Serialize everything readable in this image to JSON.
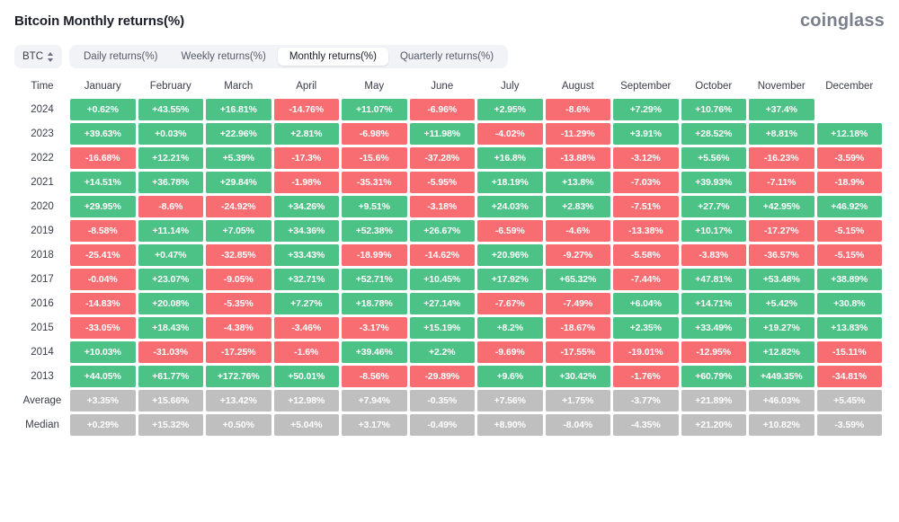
{
  "header": {
    "title": "Bitcoin Monthly returns(%)",
    "brand": "coinglass"
  },
  "controls": {
    "symbol": "BTC",
    "symbol_icon": "updown-chevron-icon",
    "tabs": [
      {
        "label": "Daily returns(%)",
        "active": false
      },
      {
        "label": "Weekly returns(%)",
        "active": false
      },
      {
        "label": "Monthly returns(%)",
        "active": true
      },
      {
        "label": "Quarterly returns(%)",
        "active": false
      }
    ]
  },
  "colors": {
    "positive": "#4cc286",
    "negative": "#f76d72",
    "neutral": "#bfbfbf",
    "brand": "#7a7f8c",
    "tabbar_bg": "#f1f3f6"
  },
  "chart_data": {
    "type": "heatmap",
    "title": "Bitcoin Monthly returns(%)",
    "xlabel": "",
    "ylabel": "Time",
    "columns": [
      "Time",
      "January",
      "February",
      "March",
      "April",
      "May",
      "June",
      "July",
      "August",
      "September",
      "October",
      "November",
      "December"
    ],
    "categories": [
      "January",
      "February",
      "March",
      "April",
      "May",
      "June",
      "July",
      "August",
      "September",
      "October",
      "November",
      "December"
    ],
    "rows": [
      {
        "label": "2024",
        "kind": "year",
        "values": [
          "+0.62%",
          "+43.55%",
          "+16.81%",
          "-14.76%",
          "+11.07%",
          "-6.96%",
          "+2.95%",
          "-8.6%",
          "+7.29%",
          "+10.76%",
          "+37.4%",
          ""
        ]
      },
      {
        "label": "2023",
        "kind": "year",
        "values": [
          "+39.63%",
          "+0.03%",
          "+22.96%",
          "+2.81%",
          "-6.98%",
          "+11.98%",
          "-4.02%",
          "-11.29%",
          "+3.91%",
          "+28.52%",
          "+8.81%",
          "+12.18%"
        ]
      },
      {
        "label": "2022",
        "kind": "year",
        "values": [
          "-16.68%",
          "+12.21%",
          "+5.39%",
          "-17.3%",
          "-15.6%",
          "-37.28%",
          "+16.8%",
          "-13.88%",
          "-3.12%",
          "+5.56%",
          "-16.23%",
          "-3.59%"
        ]
      },
      {
        "label": "2021",
        "kind": "year",
        "values": [
          "+14.51%",
          "+36.78%",
          "+29.84%",
          "-1.98%",
          "-35.31%",
          "-5.95%",
          "+18.19%",
          "+13.8%",
          "-7.03%",
          "+39.93%",
          "-7.11%",
          "-18.9%"
        ]
      },
      {
        "label": "2020",
        "kind": "year",
        "values": [
          "+29.95%",
          "-8.6%",
          "-24.92%",
          "+34.26%",
          "+9.51%",
          "-3.18%",
          "+24.03%",
          "+2.83%",
          "-7.51%",
          "+27.7%",
          "+42.95%",
          "+46.92%"
        ]
      },
      {
        "label": "2019",
        "kind": "year",
        "values": [
          "-8.58%",
          "+11.14%",
          "+7.05%",
          "+34.36%",
          "+52.38%",
          "+26.67%",
          "-6.59%",
          "-4.6%",
          "-13.38%",
          "+10.17%",
          "-17.27%",
          "-5.15%"
        ]
      },
      {
        "label": "2018",
        "kind": "year",
        "values": [
          "-25.41%",
          "+0.47%",
          "-32.85%",
          "+33.43%",
          "-18.99%",
          "-14.62%",
          "+20.96%",
          "-9.27%",
          "-5.58%",
          "-3.83%",
          "-36.57%",
          "-5.15%"
        ]
      },
      {
        "label": "2017",
        "kind": "year",
        "values": [
          "-0.04%",
          "+23.07%",
          "-9.05%",
          "+32.71%",
          "+52.71%",
          "+10.45%",
          "+17.92%",
          "+65.32%",
          "-7.44%",
          "+47.81%",
          "+53.48%",
          "+38.89%"
        ]
      },
      {
        "label": "2016",
        "kind": "year",
        "values": [
          "-14.83%",
          "+20.08%",
          "-5.35%",
          "+7.27%",
          "+18.78%",
          "+27.14%",
          "-7.67%",
          "-7.49%",
          "+6.04%",
          "+14.71%",
          "+5.42%",
          "+30.8%"
        ]
      },
      {
        "label": "2015",
        "kind": "year",
        "values": [
          "-33.05%",
          "+18.43%",
          "-4.38%",
          "-3.46%",
          "-3.17%",
          "+15.19%",
          "+8.2%",
          "-18.67%",
          "+2.35%",
          "+33.49%",
          "+19.27%",
          "+13.83%"
        ]
      },
      {
        "label": "2014",
        "kind": "year",
        "values": [
          "+10.03%",
          "-31.03%",
          "-17.25%",
          "-1.6%",
          "+39.46%",
          "+2.2%",
          "-9.69%",
          "-17.55%",
          "-19.01%",
          "-12.95%",
          "+12.82%",
          "-15.11%"
        ]
      },
      {
        "label": "2013",
        "kind": "year",
        "values": [
          "+44.05%",
          "+61.77%",
          "+172.76%",
          "+50.01%",
          "-8.56%",
          "-29.89%",
          "+9.6%",
          "+30.42%",
          "-1.76%",
          "+60.79%",
          "+449.35%",
          "-34.81%"
        ]
      },
      {
        "label": "Average",
        "kind": "summary",
        "values": [
          "+3.35%",
          "+15.66%",
          "+13.42%",
          "+12.98%",
          "+7.94%",
          "-0.35%",
          "+7.56%",
          "+1.75%",
          "-3.77%",
          "+21.89%",
          "+46.03%",
          "+5.45%"
        ]
      },
      {
        "label": "Median",
        "kind": "summary",
        "values": [
          "+0.29%",
          "+15.32%",
          "+0.50%",
          "+5.04%",
          "+3.17%",
          "-0.49%",
          "+8.90%",
          "-8.04%",
          "-4.35%",
          "+21.20%",
          "+10.82%",
          "-3.59%"
        ]
      }
    ]
  }
}
